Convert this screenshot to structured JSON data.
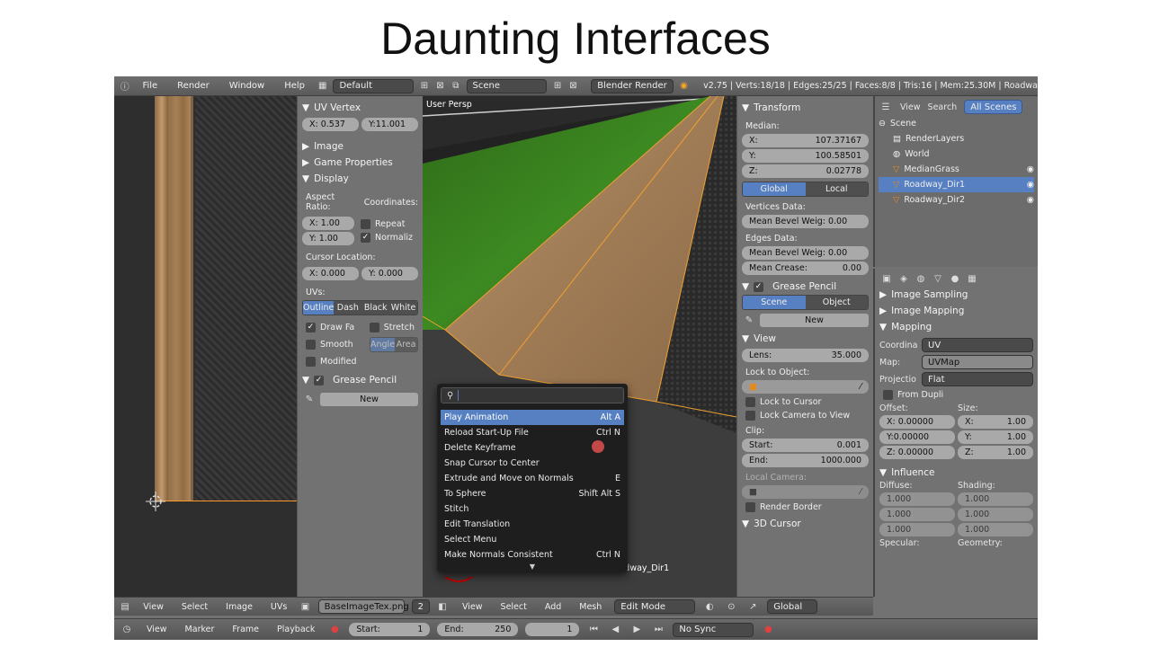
{
  "slide": {
    "title": "Daunting Interfaces"
  },
  "topbar": {
    "menus": [
      "File",
      "Render",
      "Window",
      "Help"
    ],
    "layout": "Default",
    "scene": "Scene",
    "engine": "Blender Render",
    "stats": "v2.75 | Verts:18/18 | Edges:25/25 | Faces:8/8 | Tris:16 | Mem:25.30M | Roadwa"
  },
  "uv_panel": {
    "uv_vertex_header": "UV Vertex",
    "uv_x": "X: 0.537",
    "uv_y": "Y:11.001",
    "image_header": "Image",
    "game_props_header": "Game Properties",
    "display_header": "Display",
    "aspect_ratio_label": "Aspect Ratio:",
    "coordinates_label": "Coordinates:",
    "aspect_x": "X: 1.00",
    "aspect_y": "Y: 1.00",
    "repeat_label": "Repeat",
    "normalize_label": "Normaliz",
    "cursor_location_label": "Cursor Location:",
    "cursor_x": "X: 0.000",
    "cursor_y": "Y: 0.000",
    "uvs_label": "UVs:",
    "uv_modes": [
      "Outline",
      "Dash",
      "Black",
      "White"
    ],
    "draw_faces_label": "Draw Fa",
    "stretch_label": "Stretch",
    "smooth_label": "Smooth",
    "angle_label": "Angle",
    "area_label": "Area",
    "modified_label": "Modified",
    "grease_pencil_header": "Grease Pencil",
    "new_label": "New"
  },
  "uv_bottombar": {
    "menus": [
      "View",
      "Select",
      "Image",
      "UVs"
    ],
    "image_name": "BaseImageTex.png",
    "users": "2"
  },
  "viewport": {
    "view_label": "User Persp",
    "object_label": "(1) Roadway_Dir1",
    "menus": [
      "View",
      "Select",
      "Add",
      "Mesh"
    ],
    "mode": "Edit Mode",
    "orientation": "Global"
  },
  "search_popup": {
    "items": [
      {
        "label": "Play Animation",
        "shortcut": "Alt A"
      },
      {
        "label": "Reload Start-Up File",
        "shortcut": "Ctrl N"
      },
      {
        "label": "Delete Keyframe",
        "shortcut": ""
      },
      {
        "label": "Snap Cursor to Center",
        "shortcut": ""
      },
      {
        "label": "Extrude and Move on Normals",
        "shortcut": "E"
      },
      {
        "label": "To Sphere",
        "shortcut": "Shift Alt S"
      },
      {
        "label": "Stitch",
        "shortcut": ""
      },
      {
        "label": "Edit Translation",
        "shortcut": ""
      },
      {
        "label": "Select Menu",
        "shortcut": ""
      },
      {
        "label": "Make Normals Consistent",
        "shortcut": "Ctrl N"
      }
    ]
  },
  "props_panel": {
    "transform_header": "Transform",
    "median_label": "Median:",
    "median_x_label": "X:",
    "median_x": "107.37167",
    "median_y_label": "Y:",
    "median_y": "100.58501",
    "median_z_label": "Z:",
    "median_z": "0.02778",
    "global_label": "Global",
    "local_label": "Local",
    "vertices_data_label": "Vertices Data:",
    "vert_bevel": "Mean Bevel Weig: 0.00",
    "edges_data_label": "Edges Data:",
    "edge_bevel": "Mean Bevel Weig: 0.00",
    "mean_crease_label": "Mean Crease:",
    "mean_crease": "0.00",
    "grease_pencil_header": "Grease Pencil",
    "scene_label": "Scene",
    "object_label": "Object",
    "new_label": "New",
    "view_header": "View",
    "lens_label": "Lens:",
    "lens": "35.000",
    "lock_object_label": "Lock to Object:",
    "lock_cursor_label": "Lock to Cursor",
    "lock_camera_label": "Lock Camera to View",
    "clip_label": "Clip:",
    "clip_start_label": "Start:",
    "clip_start": "0.001",
    "clip_end_label": "End:",
    "clip_end": "1000.000",
    "local_camera_label": "Local Camera:",
    "render_border_label": "Render Border",
    "cursor3d_header": "3D Cursor"
  },
  "outliner": {
    "tabs": [
      "View",
      "Search",
      "All Scenes"
    ],
    "rows": [
      "Scene",
      "RenderLayers",
      "World",
      "MedianGrass",
      "Roadway_Dir1",
      "Roadway_Dir2"
    ]
  },
  "texture_props": {
    "image_sampling_header": "Image Sampling",
    "image_mapping_header": "Image Mapping",
    "mapping_header": "Mapping",
    "coordinates_label": "Coordina",
    "coordinates_value": "UV",
    "map_label": "Map:",
    "map_value": "UVMap",
    "projection_label": "Projectio",
    "projection_value": "Flat",
    "from_dupli_label": "From Dupli",
    "offset_label": "Offset:",
    "size_label": "Size:",
    "offset_x": "X: 0.00000",
    "offset_y": "Y:0.00000",
    "offset_z": "Z: 0.00000",
    "size_x_label": "X:",
    "size_x": "1.00",
    "size_y_label": "Y:",
    "size_y": "1.00",
    "size_z_label": "Z:",
    "size_z": "1.00",
    "influence_header": "Influence",
    "diffuse_label": "Diffuse:",
    "shading_label": "Shading:",
    "value_1000": "1.000",
    "specular_label": "Specular:",
    "geometry_label": "Geometry:"
  },
  "timeline": {
    "menus": [
      "View",
      "Marker",
      "Frame",
      "Playback"
    ],
    "start_label": "Start:",
    "start": "1",
    "end_label": "End:",
    "end": "250",
    "current": "1",
    "sync": "No Sync"
  }
}
